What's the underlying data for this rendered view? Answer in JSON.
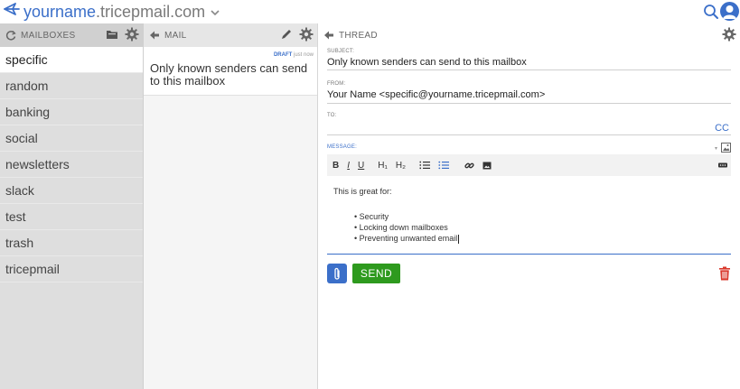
{
  "app": {
    "username": "yourname",
    "domain": ".tricepmail.com",
    "accent_color": "#3b6fc9",
    "send_color": "#2e9a1e",
    "delete_color": "#d9382c"
  },
  "mailboxes": {
    "header": "MAILBOXES",
    "items": [
      {
        "label": "specific"
      },
      {
        "label": "random"
      },
      {
        "label": "banking"
      },
      {
        "label": "social"
      },
      {
        "label": "newsletters"
      },
      {
        "label": "slack"
      },
      {
        "label": "test"
      },
      {
        "label": "trash"
      },
      {
        "label": "tricepmail"
      }
    ]
  },
  "mail": {
    "header": "MAIL",
    "items": [
      {
        "badge": "DRAFT",
        "time": "just now",
        "subject": "Only known senders can send to this mailbox"
      }
    ]
  },
  "thread": {
    "header": "THREAD",
    "subject_label": "SUBJECT:",
    "subject_value": "Only known senders can send to this mailbox",
    "from_label": "FROM:",
    "from_value": "Your Name <specific@yourname.tricepmail.com>",
    "to_label": "TO:",
    "to_value": "",
    "cc_label": "CC",
    "message_label": "MESSAGE:",
    "toolbar": {
      "bold": "B",
      "italic": "I",
      "underline": "U",
      "h1": "H₁",
      "h2": "H₂"
    },
    "body_intro": "This is great for:",
    "body_bullets": [
      "Security",
      "Locking down mailboxes",
      "Preventing unwanted email"
    ],
    "send_label": "SEND"
  }
}
